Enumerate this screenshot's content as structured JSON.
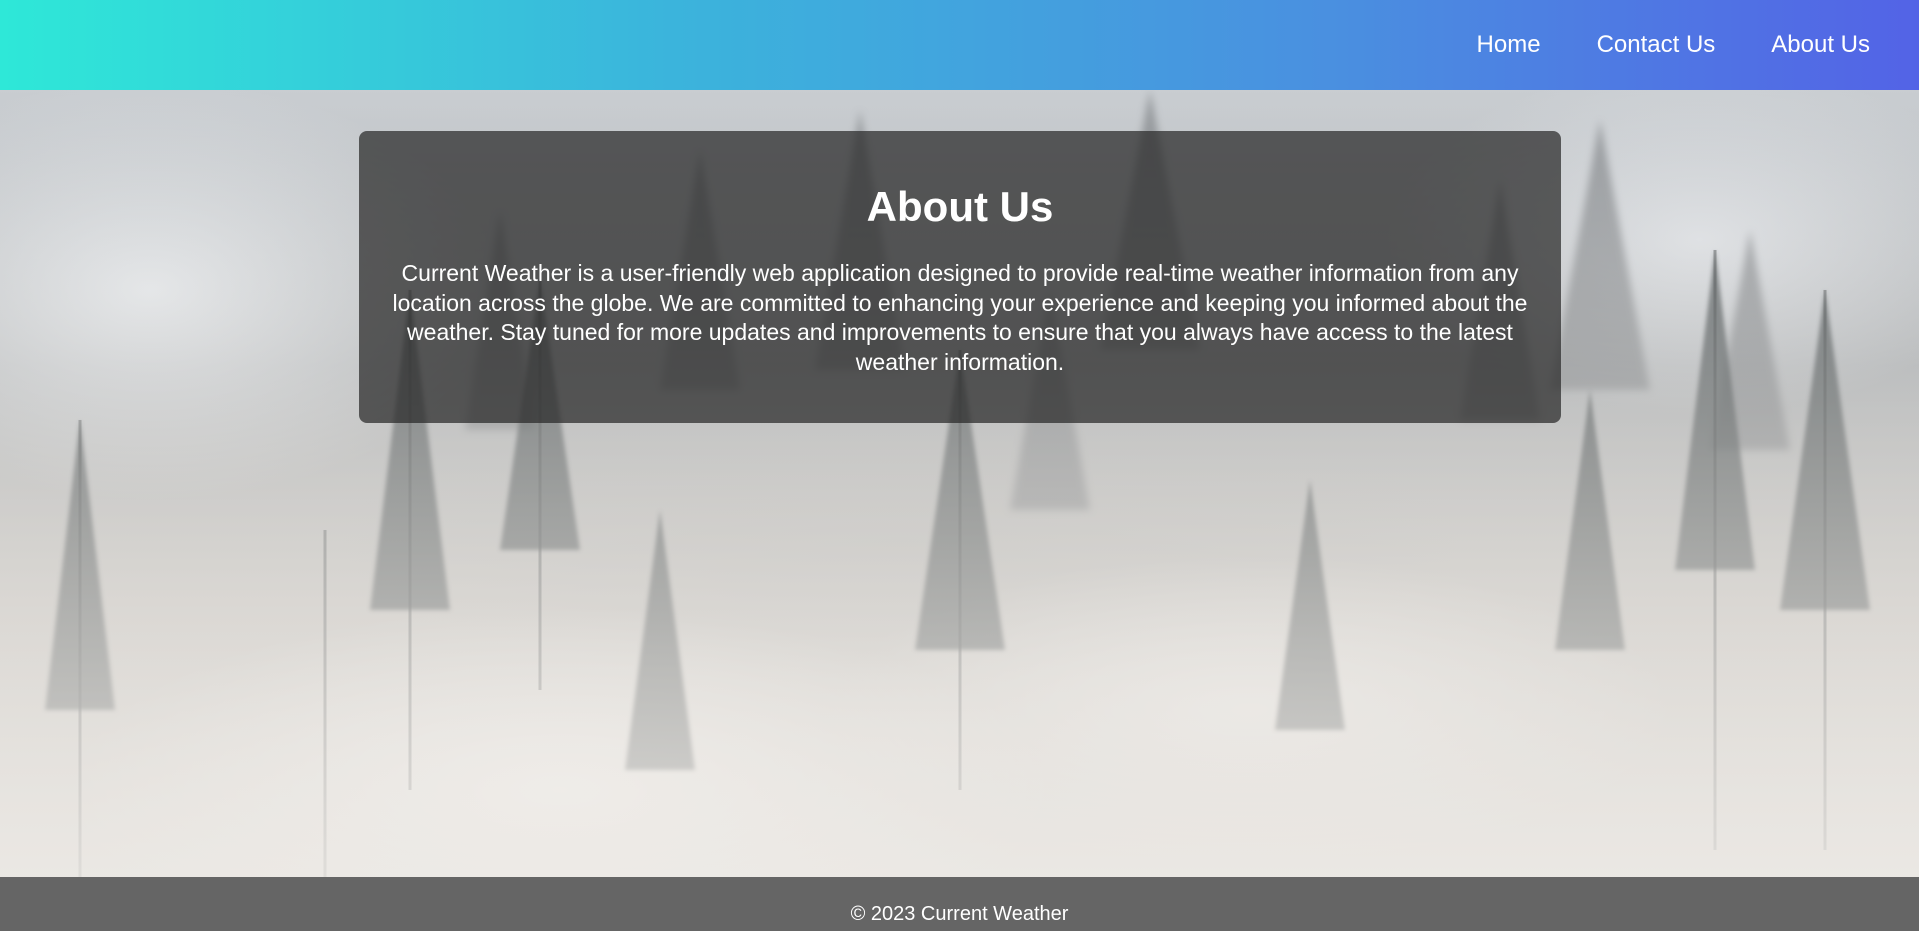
{
  "nav": {
    "home_label": "Home",
    "contact_label": "Contact Us",
    "about_label": "About Us"
  },
  "about": {
    "title": "About Us",
    "body": "Current Weather is a user-friendly web application designed to provide real-time weather information from any location across the globe. We are committed to enhancing your experience and keeping you informed about the weather. Stay tuned for more updates and improvements to ensure that you always have access to the latest weather information."
  },
  "footer": {
    "copyright": "© 2023 Current Weather"
  },
  "colors": {
    "header_gradient_start": "#2ee8d8",
    "header_gradient_end": "#5363e6",
    "card_background": "rgba(40,40,40,0.72)",
    "footer_background": "rgba(80,80,80,0.88)",
    "text": "#ffffff"
  },
  "background_image": "foggy-forest"
}
